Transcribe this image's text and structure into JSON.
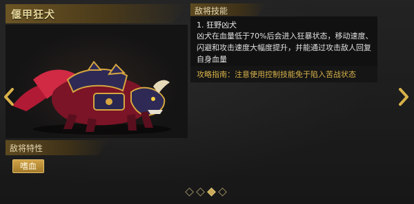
{
  "title": "偃甲狂犬",
  "trait": {
    "header": "敌将特性",
    "badges": [
      "嗜血"
    ]
  },
  "skill": {
    "header": "敌将技能",
    "name": "1. 狂野凶犬",
    "description": "凶犬在血量低于70%后会进入狂暴状态，移动速度、闪避和攻击速度大幅度提升，并能通过攻击敌人回复自身血量",
    "tip": "攻略指南：注意使用控制技能免于陷入苦战状态"
  },
  "pagination": {
    "total": 4,
    "active_index": 2
  },
  "colors": {
    "gold": "#d8b24a",
    "badge": "#c0923a",
    "beast_red": "#c8223a",
    "armor_purple": "#2e2a55"
  },
  "icons": {
    "left_arrow": "chevron-left-icon",
    "right_arrow": "chevron-right-icon"
  }
}
